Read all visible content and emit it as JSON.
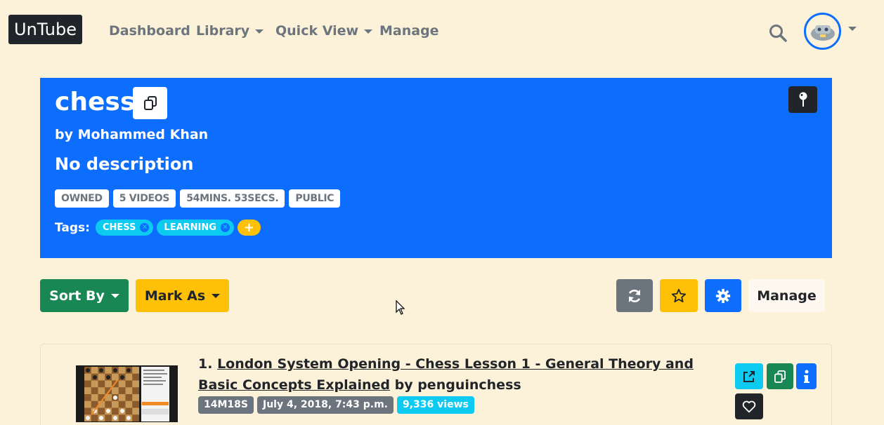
{
  "nav": {
    "brand": "UnTube",
    "dashboard": "Dashboard",
    "library": "Library",
    "quick_view": "Quick View",
    "manage": "Manage"
  },
  "playlist": {
    "title": "chess",
    "by": "by Mohammed Khan",
    "description": "No description",
    "badges": [
      "OWNED",
      "5 VIDEOS",
      "54MINS. 53SECS.",
      "PUBLIC"
    ],
    "tags_label": "Tags:",
    "tags": [
      "CHESS",
      "LEARNING"
    ]
  },
  "toolbar": {
    "sort_by": "Sort By",
    "mark_as": "Mark As",
    "manage": "Manage"
  },
  "videos": [
    {
      "index": "1.",
      "title": "London System Opening - Chess Lesson 1 - General Theory and Basic Concepts Explained",
      "channel": "by penguinchess",
      "duration": "14M18S",
      "date": "July 4, 2018, 7:43 p.m.",
      "views": "9,336 views"
    }
  ],
  "colors": {
    "background": "#fbf2d9",
    "primary": "#0d6efd",
    "success": "#198754",
    "warning": "#ffc107",
    "info": "#0dcaf0",
    "secondary": "#6c757d",
    "dark": "#212529"
  }
}
